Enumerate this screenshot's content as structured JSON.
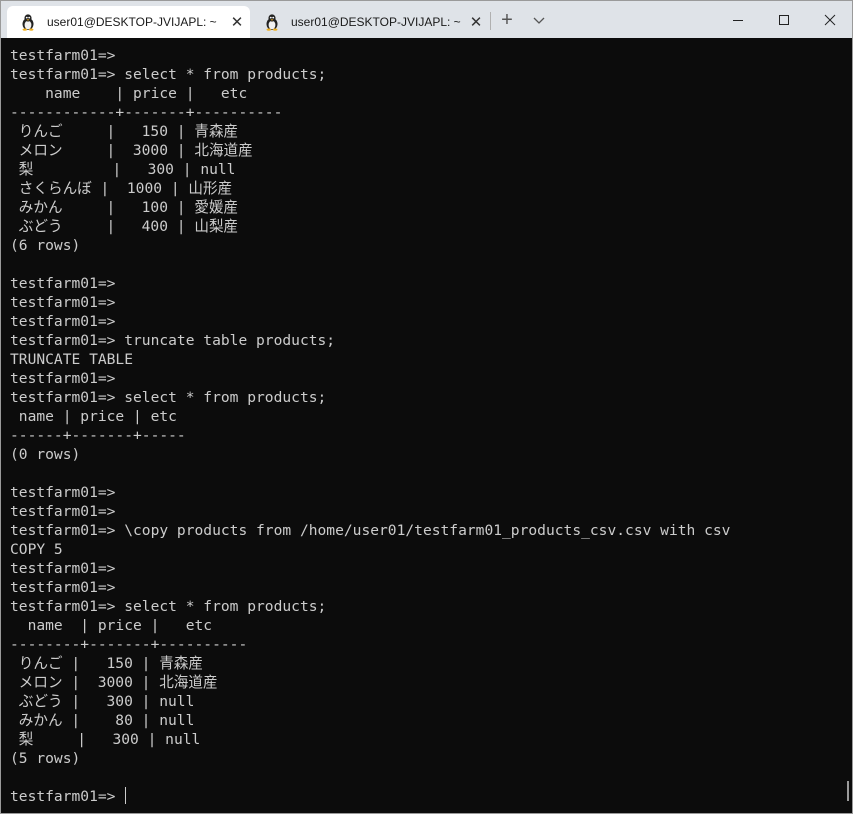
{
  "tabs": [
    {
      "title": "user01@DESKTOP-JVIJAPL: ~",
      "close": "✕",
      "icon": "tux-icon",
      "active": true
    },
    {
      "title": "user01@DESKTOP-JVIJAPL: ~",
      "close": "✕",
      "icon": "tux-icon",
      "active": false
    }
  ],
  "toolbar": {
    "new_tab_label": "+",
    "dropdown_label": "⌄"
  },
  "window_controls": {
    "minimize": "—",
    "maximize": "☐",
    "close": "✕"
  },
  "terminal": {
    "lines": [
      "testfarm01=>",
      "testfarm01=> select * from products;",
      "    name    | price |   etc",
      "------------+-------+----------",
      " りんご     |   150 | 青森産",
      " メロン     |  3000 | 北海道産",
      " 梨         |   300 | null",
      " さくらんぼ |  1000 | 山形産",
      " みかん     |   100 | 愛媛産",
      " ぶどう     |   400 | 山梨産",
      "(6 rows)",
      "",
      "testfarm01=>",
      "testfarm01=>",
      "testfarm01=>",
      "testfarm01=> truncate table products;",
      "TRUNCATE TABLE",
      "testfarm01=>",
      "testfarm01=> select * from products;",
      " name | price | etc",
      "------+-------+-----",
      "(0 rows)",
      "",
      "testfarm01=>",
      "testfarm01=>",
      "testfarm01=> \\copy products from /home/user01/testfarm01_products_csv.csv with csv",
      "COPY 5",
      "testfarm01=>",
      "testfarm01=>",
      "testfarm01=> select * from products;",
      "  name  | price |   etc",
      "--------+-------+----------",
      " りんご |   150 | 青森産",
      " メロン |  3000 | 北海道産",
      " ぶどう |   300 | null",
      " みかん |    80 | null",
      " 梨     |   300 | null",
      "(5 rows)",
      ""
    ],
    "prompt": "testfarm01=> "
  },
  "colors": {
    "terminal_bg": "#0c0c0c",
    "terminal_fg": "#cccccc",
    "tabbar_bg": "#dfe3e8",
    "active_tab_bg": "#ffffff"
  }
}
